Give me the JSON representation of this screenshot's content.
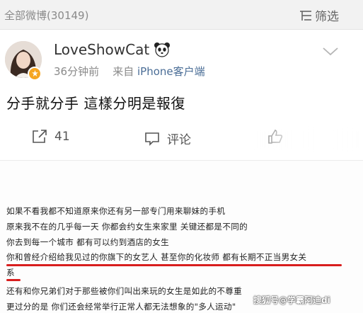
{
  "header": {
    "all_weibo": "全部微博(30149)",
    "filter_label": "筛选"
  },
  "post": {
    "username": "LoveShowCat",
    "time": "36分钟前",
    "source_prefix": "来自",
    "source": "iPhone客户端",
    "text": "分手就分手 這樣分明是報復"
  },
  "actions": {
    "repost_count": "41",
    "comment_label": "评论"
  },
  "screenshot_text": {
    "lines": [
      "如果不看我都不知道原来你还有另一部专门用来聊妹的手机",
      "原来我不在的几乎每一天  你都会约女生来家里 关键还都是不同的",
      "你去到每一个城市 都有可以约到酒店的女生",
      "你和曾经介绍给我见过的你旗下的女艺人 甚至你的化妆师 都有长期不正当男女关",
      "系",
      "还有和你兄弟们对于那些被你们叫出来玩的女生是如此的不尊重",
      "更过分的是 你们还会经常举行正常人都无法想象的\"多人运动\""
    ]
  },
  "watermark": "搜狐号@学霸阿迪di",
  "colors": {
    "link_blue": "#4a6d96",
    "badge_orange": "#f5a623",
    "underline_red": "#d81e1e"
  }
}
